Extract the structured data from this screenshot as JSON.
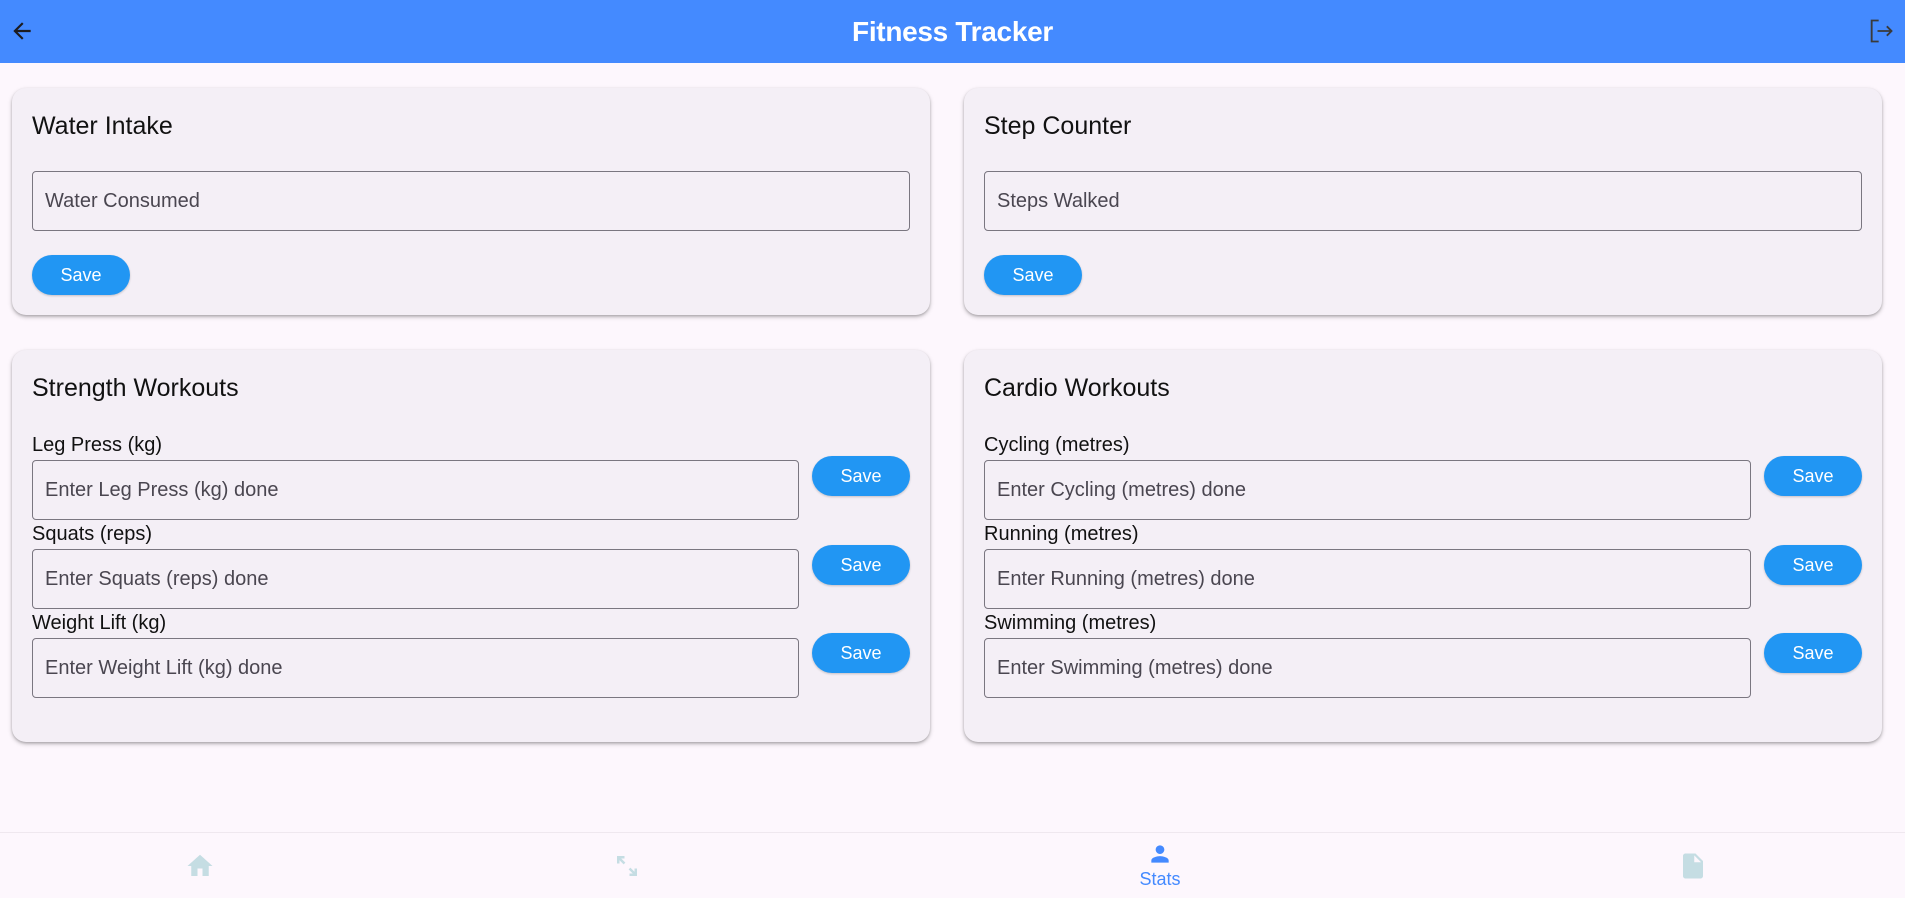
{
  "app_bar": {
    "title": "Fitness Tracker",
    "back_icon": "arrow-back-icon",
    "logout_icon": "logout-icon",
    "color": "#448aff"
  },
  "water_intake": {
    "title": "Water Intake",
    "input_placeholder": "Water Consumed",
    "input_value": "",
    "save_label": "Save"
  },
  "step_counter": {
    "title": "Step Counter",
    "input_placeholder": "Steps Walked",
    "input_value": "",
    "save_label": "Save"
  },
  "strength_workouts": {
    "title": "Strength Workouts",
    "exercises": [
      {
        "label": "Leg Press (kg)",
        "placeholder": "Enter Leg Press (kg) done",
        "save_label": "Save"
      },
      {
        "label": "Squats (reps)",
        "placeholder": "Enter Squats (reps) done",
        "save_label": "Save"
      },
      {
        "label": "Weight Lift (kg)",
        "placeholder": "Enter Weight Lift (kg) done",
        "save_label": "Save"
      }
    ]
  },
  "cardio_workouts": {
    "title": "Cardio Workouts",
    "exercises": [
      {
        "label": "Cycling (metres)",
        "placeholder": "Enter Cycling (metres) done",
        "save_label": "Save"
      },
      {
        "label": "Running (metres)",
        "placeholder": "Enter Running (metres) done",
        "save_label": "Save"
      },
      {
        "label": "Swimming (metres)",
        "placeholder": "Enter Swimming (metres) done",
        "save_label": "Save"
      }
    ]
  },
  "bottom_nav": {
    "items": [
      {
        "icon": "home-icon",
        "label": "",
        "active": false
      },
      {
        "icon": "expand-arrows-icon",
        "label": "",
        "active": false
      },
      {
        "icon": "person-icon",
        "label": "Stats",
        "active": true
      },
      {
        "icon": "document-icon",
        "label": "",
        "active": false
      }
    ],
    "active_color": "#448aff",
    "inactive_color": "#c5dde3"
  },
  "colors": {
    "button": "#2196f3",
    "card_background": "#f4eff6",
    "page_background": "#fdf7fd"
  }
}
